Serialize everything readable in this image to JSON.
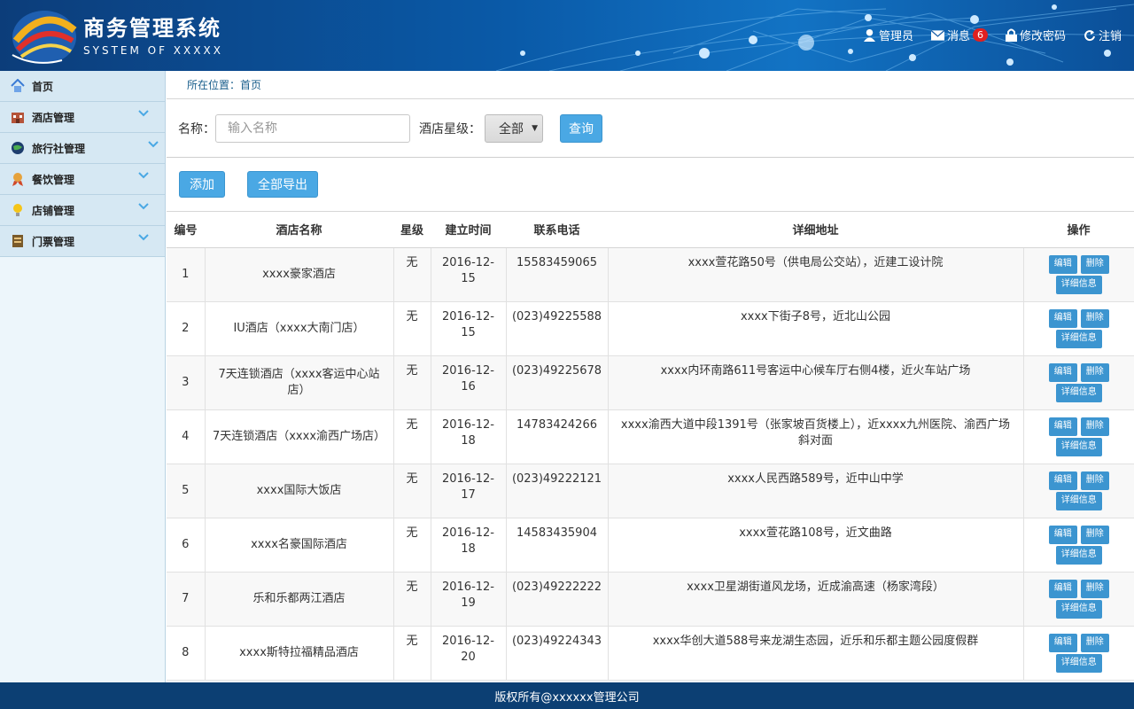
{
  "header": {
    "title": "商务管理系统",
    "subtitle": "SYSTEM OF XXXXX",
    "links": {
      "admin": "管理员",
      "messages": "消息",
      "message_count": "6",
      "change_password": "修改密码",
      "logout": "注销"
    }
  },
  "sidebar": {
    "items": [
      {
        "label": "首页",
        "icon": "home-icon"
      },
      {
        "label": "酒店管理",
        "icon": "hotel-icon"
      },
      {
        "label": "旅行社管理",
        "icon": "globe-icon"
      },
      {
        "label": "餐饮管理",
        "icon": "medal-icon"
      },
      {
        "label": "店铺管理",
        "icon": "bulb-icon"
      },
      {
        "label": "门票管理",
        "icon": "ticket-icon"
      }
    ]
  },
  "breadcrumb": {
    "text": "所在位置：首页"
  },
  "search": {
    "name_label": "名称：",
    "name_placeholder": "输入名称",
    "star_label": "酒店星级：",
    "star_value": "全部",
    "query_label": "查询"
  },
  "actions": {
    "add_label": "添加",
    "export_label": "全部导出"
  },
  "table": {
    "headers": [
      "编号",
      "酒店名称",
      "星级",
      "建立时间",
      "联系电话",
      "详细地址",
      "操作"
    ],
    "op_labels": {
      "edit": "编辑",
      "delete": "删除",
      "detail": "详细信息"
    },
    "rows": [
      {
        "id": "1",
        "name": "xxxx豪家酒店",
        "star": "无",
        "date": "2016-12-15",
        "phone": "15583459065",
        "address": "xxxx萱花路50号（供电局公交站），近建工设计院"
      },
      {
        "id": "2",
        "name": "IU酒店（xxxx大南门店）",
        "star": "无",
        "date": "2016-12-15",
        "phone": "(023)49225588",
        "address": "xxxx下街子8号，近北山公园"
      },
      {
        "id": "3",
        "name": "7天连锁酒店（xxxx客运中心站店）",
        "star": "无",
        "date": "2016-12-16",
        "phone": "(023)49225678",
        "address": "xxxx内环南路611号客运中心候车厅右侧4楼，近火车站广场"
      },
      {
        "id": "4",
        "name": "7天连锁酒店（xxxx渝西广场店）",
        "star": "无",
        "date": "2016-12-18",
        "phone": "14783424266",
        "address": "xxxx渝西大道中段1391号（张家坡百货楼上），近xxxx九州医院、渝西广场斜对面"
      },
      {
        "id": "5",
        "name": "xxxx国际大饭店",
        "star": "无",
        "date": "2016-12-17",
        "phone": "(023)49222121",
        "address": "xxxx人民西路589号，近中山中学"
      },
      {
        "id": "6",
        "name": "xxxx名豪国际酒店",
        "star": "无",
        "date": "2016-12-18",
        "phone": "14583435904",
        "address": "xxxx萱花路108号，近文曲路"
      },
      {
        "id": "7",
        "name": "乐和乐都两江酒店",
        "star": "无",
        "date": "2016-12-19",
        "phone": "(023)49222222",
        "address": "xxxx卫星湖街道风龙场，近成渝高速（杨家湾段）"
      },
      {
        "id": "8",
        "name": "xxxx斯特拉福精品酒店",
        "star": "无",
        "date": "2016-12-20",
        "phone": "(023)49224343",
        "address": "xxxx华创大道588号来龙湖生态园，近乐和乐都主题公园度假群"
      }
    ]
  },
  "footer": {
    "text": "版权所有@xxxxxx管理公司"
  }
}
